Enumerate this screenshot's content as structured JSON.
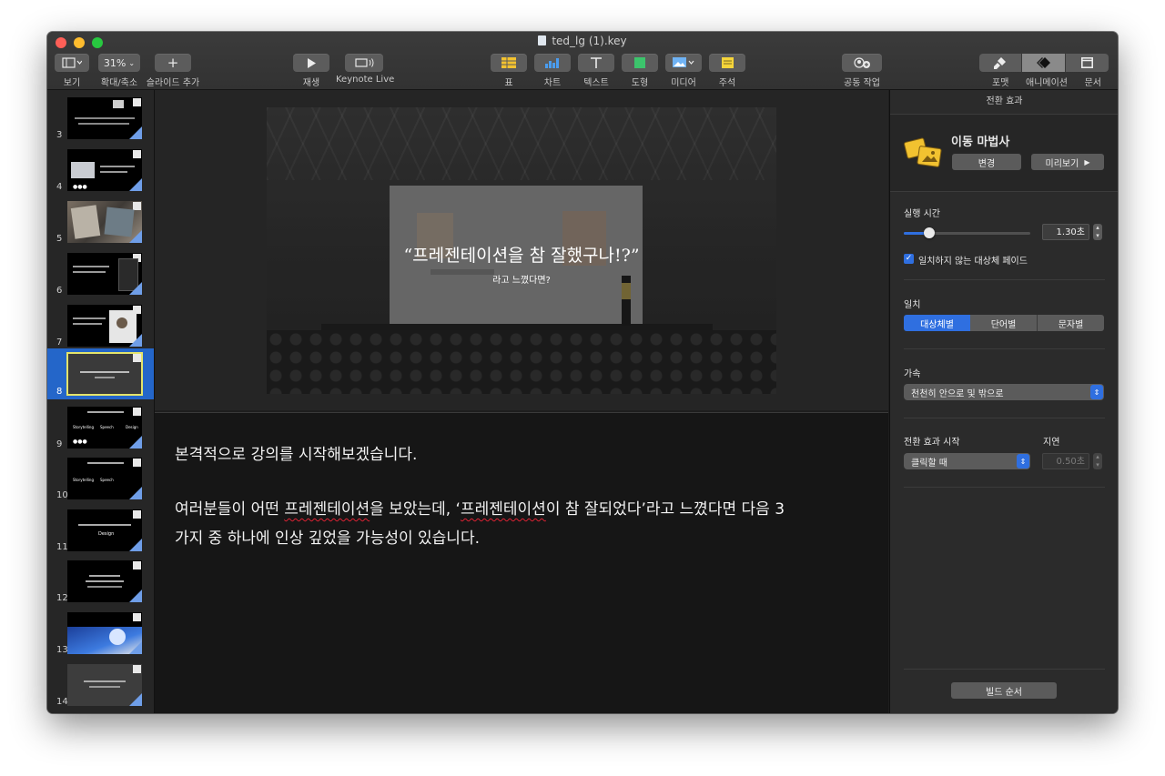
{
  "window": {
    "title": "ted_lg (1).key"
  },
  "toolbar": {
    "view": "보기",
    "zoom_value": "31%",
    "zoom": "확대/축소",
    "add_slide": "슬라이드 추가",
    "play": "재생",
    "keynote_live": "Keynote Live",
    "table": "표",
    "chart": "차트",
    "text": "텍스트",
    "shape": "도형",
    "media": "미디어",
    "comment": "주석",
    "collaborate": "공동 작업",
    "format": "포맷",
    "animate": "애니메이션",
    "document": "문서"
  },
  "slides": [
    {
      "num": "3"
    },
    {
      "num": "4"
    },
    {
      "num": "5"
    },
    {
      "num": "6"
    },
    {
      "num": "7"
    },
    {
      "num": "8"
    },
    {
      "num": "9"
    },
    {
      "num": "10"
    },
    {
      "num": "11"
    },
    {
      "num": "12"
    },
    {
      "num": "13"
    },
    {
      "num": "14"
    }
  ],
  "thumb_text": {
    "storytelling": "Storytelling",
    "speech": "Speech",
    "design": "Design"
  },
  "slide": {
    "quote": "“프레젠테이션을 참 잘했구나!?”",
    "sub": "라고 느꼈다면?"
  },
  "notes": {
    "p1": "본격적으로 강의를 시작해보겠습니다.",
    "p2_before": "여러분들이 어떤 ",
    "p2_word1": "프레젠테이션",
    "p2_mid": "을 보았는데, ‘",
    "p2_word2": "프레젠테이션",
    "p2_after": "이 참 잘되었다’라고 느꼈다면 다음 3",
    "p3": "가지 중 하나에 인상 깊었을 가능성이 있습니다."
  },
  "inspector": {
    "header": "전환 효과",
    "effect_name": "이동 마법사",
    "change": "변경",
    "preview": "미리보기",
    "duration_label": "실행 시간",
    "duration_value": "1.30초",
    "duration_fraction": 0.2,
    "fade_label": "일치하지 않는 대상체 페이드",
    "match_label": "일치",
    "match_options": [
      "대상체별",
      "단어별",
      "문자별"
    ],
    "accel_label": "가속",
    "accel_value": "천천히 안으로 및 밖으로",
    "start_label": "전환 효과 시작",
    "start_value": "클릭할 때",
    "delay_label": "지연",
    "delay_value": "0.50초",
    "build_order": "빌드 순서"
  },
  "colors": {
    "accent": "#2466c9",
    "selection": "#e4e46a",
    "icon_yellow": "#f2c230"
  }
}
